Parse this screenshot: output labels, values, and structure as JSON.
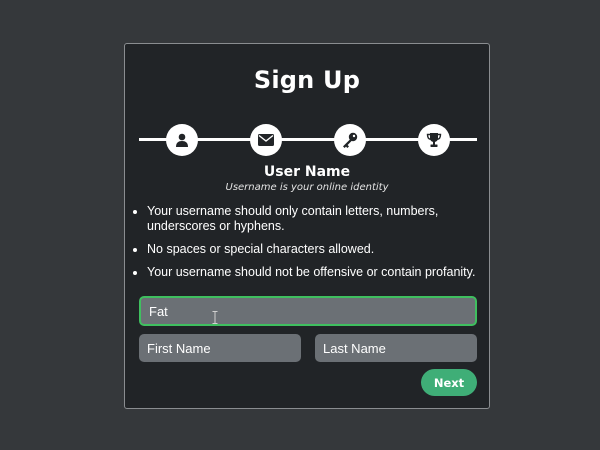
{
  "form": {
    "title": "Sign Up",
    "steps": [
      {
        "icon": "user-icon",
        "label": ""
      },
      {
        "icon": "envelope-icon",
        "label": ""
      },
      {
        "icon": "key-icon",
        "label": ""
      },
      {
        "icon": "trophy-icon",
        "label": ""
      }
    ],
    "section_title": "User Name",
    "section_subtitle": "Username is your online identity",
    "rules": [
      "Your username should only contain letters, numbers, underscores or hyphens.",
      "No spaces or special characters allowed.",
      "Your username should not be offensive or contain profanity."
    ],
    "username_value": "Fat",
    "first_name_placeholder": "First Name",
    "last_name_placeholder": "Last Name",
    "next_label": "Next"
  },
  "colors": {
    "page_background": "#35383b",
    "card_background": "#212427",
    "field_background": "#6b7075",
    "focus_border": "#3fbf5f",
    "next_button": "#3fae77"
  }
}
